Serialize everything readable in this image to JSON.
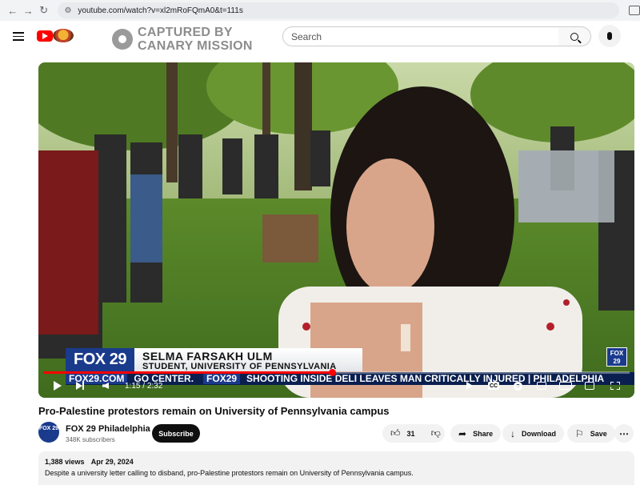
{
  "browser": {
    "url": "youtube.com/watch?v=xl2mRoFQmA0&t=111s"
  },
  "header": {
    "watermark_line1": "CAPTURED BY",
    "watermark_line2": "CANARY MISSION",
    "search_placeholder": "Search"
  },
  "player": {
    "fox_logo": "FOX 29",
    "chyron_name": "SELMA FARSAKH ULM",
    "chyron_title": "STUDENT, UNIVERSITY OF PENNSYLVANIA",
    "ticker_brand": "FOX29.COM",
    "ticker_text": "GO CENTER.",
    "ticker_brand2": "FOX29",
    "ticker_text2": "SHOOTING INSIDE DELI LEAVES MAN CRITICALLY INJURED | PHILADELPHIA",
    "bug_text": "FOX 29",
    "time_current": "1:15",
    "time_total": "2:32",
    "progress_fraction": 0.493,
    "cc_label": "CC"
  },
  "video": {
    "title": "Pro-Palestine protestors remain on University of Pennsylvania campus",
    "channel_name": "FOX 29 Philadelphia",
    "channel_avatar_text": "FOX 29",
    "subscribers": "348K subscribers",
    "subscribe_label": "Subscribe",
    "like_count": "31",
    "share_label": "Share",
    "download_label": "Download",
    "save_label": "Save"
  },
  "description": {
    "views": "1,388 views",
    "date": "Apr 29, 2024",
    "text": "Despite a university letter calling to disband, pro-Palestine protestors remain on University of Pennsylvania campus."
  },
  "colors": {
    "youtube_red": "#ff0000",
    "fox_blue": "#1a3a8c"
  }
}
